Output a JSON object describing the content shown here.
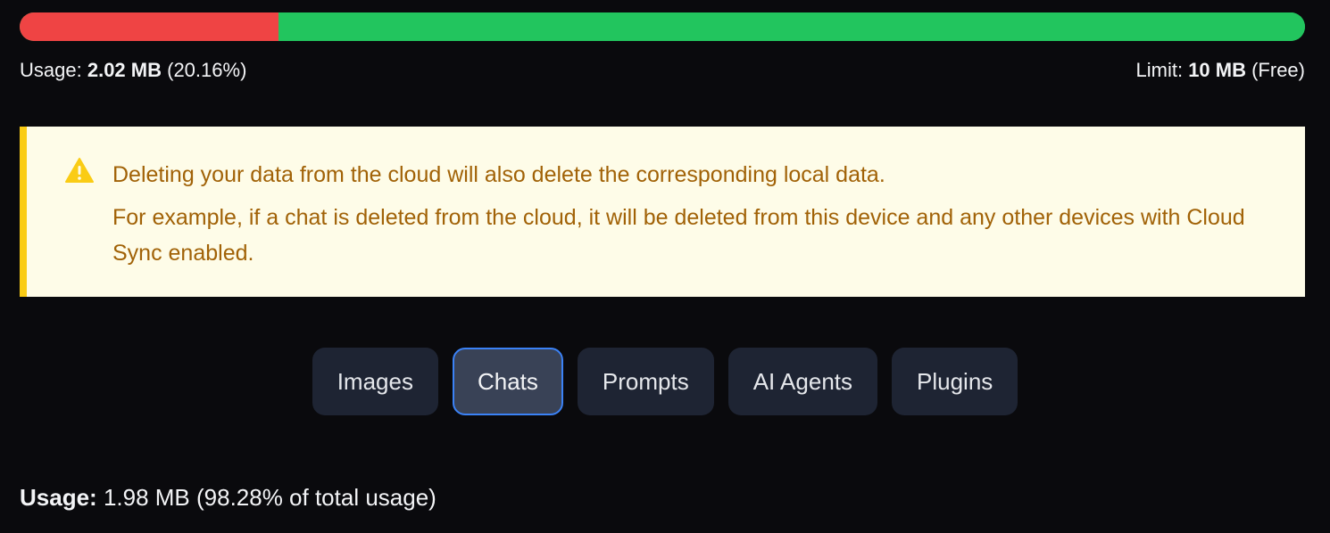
{
  "storage": {
    "used_fraction": 0.2016,
    "usage_label": "Usage:",
    "usage_value": "2.02 MB",
    "usage_percent": "(20.16%)",
    "limit_label": "Limit:",
    "limit_value": "10 MB",
    "limit_plan": "(Free)",
    "colors": {
      "used": "#ef4444",
      "free": "#22c55e"
    }
  },
  "warning": {
    "icon": "warning-triangle-icon",
    "line1": "Deleting your data from the cloud will also delete the corresponding local data.",
    "line2": "For example, if a chat is deleted from the cloud, it will be deleted from this device and any other devices with Cloud Sync enabled."
  },
  "tabs": [
    {
      "label": "Images",
      "active": false
    },
    {
      "label": "Chats",
      "active": true
    },
    {
      "label": "Prompts",
      "active": false
    },
    {
      "label": "AI Agents",
      "active": false
    },
    {
      "label": "Plugins",
      "active": false
    }
  ],
  "section": {
    "usage_label": "Usage:",
    "usage_text": "1.98 MB (98.28% of total usage)"
  }
}
